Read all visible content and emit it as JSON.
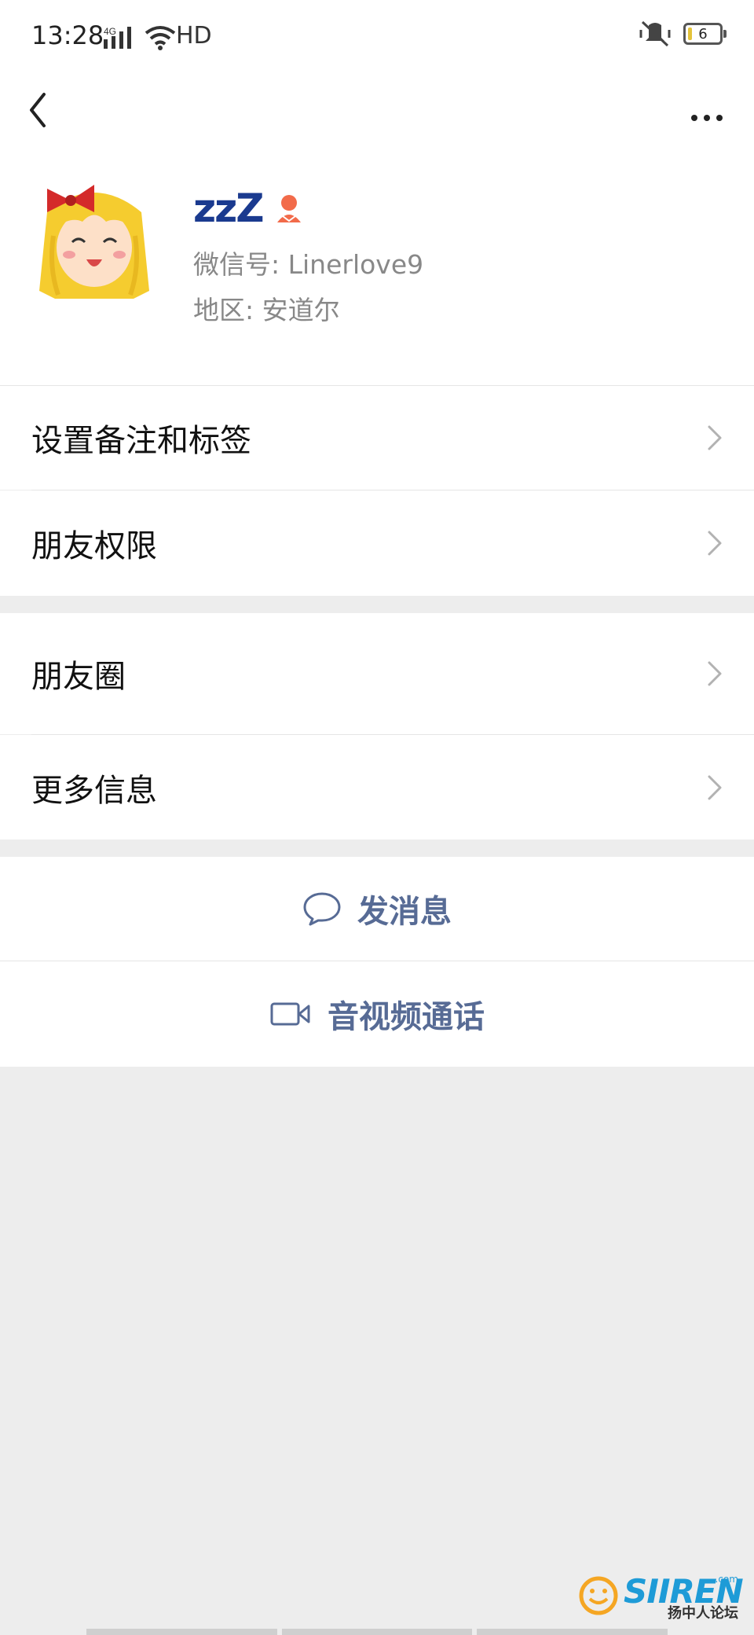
{
  "status_bar": {
    "time": "13:28",
    "network": "4G",
    "hd": "HD",
    "battery": "6"
  },
  "profile": {
    "nickname": "zzZ",
    "wechat_id": "微信号: Linerlove9",
    "region": "地区: 安道尔",
    "gender_icon_color": "#f26b4a"
  },
  "menu_group1": [
    {
      "label": "设置备注和标签"
    },
    {
      "label": "朋友权限"
    }
  ],
  "menu_group2": [
    {
      "label": "朋友圈"
    },
    {
      "label": "更多信息"
    }
  ],
  "actions": {
    "send_message": "发消息",
    "video_call": "音视频通话"
  },
  "watermark": {
    "brand": "SIIREN",
    "domain": ".com",
    "chinese": "扬中人论坛"
  },
  "colors": {
    "link": "#576b95",
    "background": "#ededed"
  }
}
